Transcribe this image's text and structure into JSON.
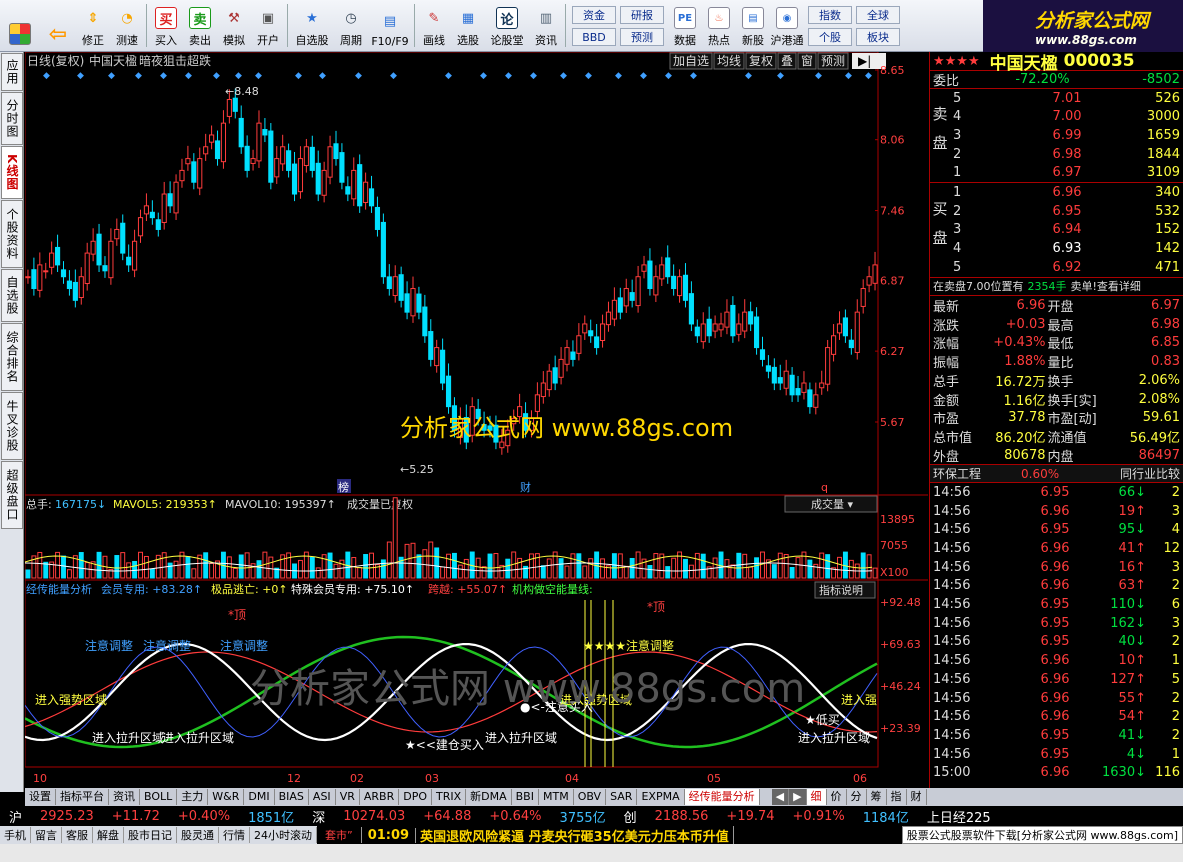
{
  "toolbar": {
    "buttons": [
      {
        "label": "修正",
        "icon": "up-down-arrow-icon"
      },
      {
        "label": "测速",
        "icon": "gauge-icon"
      },
      {
        "label": "买入",
        "icon": "buy-icon",
        "glyph": "买"
      },
      {
        "label": "卖出",
        "icon": "sell-icon",
        "glyph": "卖"
      },
      {
        "label": "模拟",
        "icon": "hammer-icon"
      },
      {
        "label": "开户",
        "icon": "lock-icon"
      },
      {
        "label": "自选股",
        "icon": "star-icon"
      },
      {
        "label": "周期",
        "icon": "clock-icon"
      },
      {
        "label": "F10/F9",
        "icon": "f10-icon"
      },
      {
        "label": "画线",
        "icon": "pen-icon"
      },
      {
        "label": "选股",
        "icon": "filter-icon"
      },
      {
        "label": "论股堂",
        "icon": "chat-icon",
        "glyph": "论"
      },
      {
        "label": "资讯",
        "icon": "news-icon"
      }
    ],
    "pair_buttons": [
      "资金",
      "研报",
      "BBD",
      "预测"
    ],
    "right_buttons": [
      {
        "label": "数据",
        "icon": "pe-icon"
      },
      {
        "label": "热点",
        "icon": "hot-icon"
      },
      {
        "label": "新股",
        "icon": "ipo-icon"
      },
      {
        "label": "沪港通",
        "icon": "sh-hk-icon"
      }
    ],
    "extra_buttons": [
      "指数",
      "全球",
      "个股",
      "板块"
    ]
  },
  "logo": {
    "title": "分析家公式网",
    "url": "www.88gs.com"
  },
  "left_tabs": [
    {
      "label": "应用"
    },
    {
      "label": "分时图"
    },
    {
      "label": "K线图",
      "active": true
    },
    {
      "label": "个股资料"
    },
    {
      "label": "自选股"
    },
    {
      "label": "综合排名"
    },
    {
      "label": "牛叉诊股"
    },
    {
      "label": "超级盘口"
    }
  ],
  "chart_header": {
    "title": "日线(复权)",
    "stock": "中国天楹",
    "note": "暗夜狙击超跌",
    "buttons": [
      "加自选",
      "均线",
      "复权",
      "叠",
      "窗",
      "预测"
    ]
  },
  "price_axis": [
    "8.65",
    "8.06",
    "7.46",
    "6.87",
    "6.27",
    "5.67"
  ],
  "annotations": {
    "high": "8.48",
    "low": "5.25",
    "mark1": "榜",
    "mark2": "财",
    "mark3": "q"
  },
  "watermark": "分析家公式网 www.88gs.com",
  "watermark2": "分析家公式网 www.88gs.com",
  "volume_header": {
    "total": "总手:",
    "total_val": "167175",
    "mavol5": "MAVOL5:",
    "mavol5_val": "219353",
    "mavol10": "MAVOL10:",
    "mavol10_val": "195397",
    "note": "成交量已复权",
    "select": "成交量"
  },
  "volume_axis": [
    "13895",
    "7055",
    "X100"
  ],
  "indicator_header": {
    "name": "经传能量分析",
    "l1": "会员专用:",
    "v1": "+83.28",
    "l2": "极品逃亡:",
    "v2": "+0",
    "l3": "特殊会员专用:",
    "v3": "+75.10",
    "l4": "跨越:",
    "v4": "+55.07",
    "l5": "机构做空能量线:",
    "help": "指标说明"
  },
  "indicator_axis": [
    "+92.48",
    "+69.63",
    "+46.24",
    "+23.39"
  ],
  "indicator_labels": [
    "注意调整",
    "注意调整",
    "注意调整",
    "进入强势区域",
    "进入拉升区域",
    "进入拉升区域",
    "★<<建仓买入",
    "进入拉升区域",
    "●<-注意买入",
    "进入强势区域",
    "★★★★注意调整",
    "*顶",
    "*顶",
    "★低买",
    "进入拉升区域",
    "进入强"
  ],
  "x_axis": [
    "10",
    "12",
    "02",
    "03",
    "04",
    "05",
    "06"
  ],
  "quote": {
    "stars": "★★★★",
    "name": "中国天楹",
    "code": "000035",
    "wei": [
      {
        "l": "委比",
        "v1": "-72.20%",
        "v2": "-8502"
      }
    ],
    "sell": [
      [
        "5",
        "7.01",
        "526"
      ],
      [
        "4",
        "7.00",
        "3000"
      ],
      [
        "3",
        "6.99",
        "1659"
      ],
      [
        "2",
        "6.98",
        "1844"
      ],
      [
        "1",
        "6.97",
        "3109"
      ]
    ],
    "buy": [
      [
        "1",
        "6.96",
        "340"
      ],
      [
        "2",
        "6.95",
        "532"
      ],
      [
        "3",
        "6.94",
        "152"
      ],
      [
        "4",
        "6.93",
        "142"
      ],
      [
        "5",
        "6.92",
        "471"
      ]
    ],
    "sell_label": "卖盘",
    "buy_label": "买盘",
    "note": "在卖盘7.00位置有",
    "note_v": "2354手",
    "note_tail": "卖单!查看详细",
    "stats": [
      [
        "最新",
        "6.96",
        "开盘",
        "6.97"
      ],
      [
        "涨跌",
        "+0.03",
        "最高",
        "6.98"
      ],
      [
        "涨幅",
        "+0.43%",
        "最低",
        "6.85"
      ],
      [
        "振幅",
        "1.88%",
        "量比",
        "0.83"
      ],
      [
        "总手",
        "16.72万",
        "换手",
        "2.06%"
      ],
      [
        "金额",
        "1.16亿",
        "换手[实]",
        "2.08%"
      ],
      [
        "市盈",
        "37.78",
        "市盈[动]",
        "59.61"
      ],
      [
        "总市值",
        "86.20亿",
        "流通值",
        "56.49亿"
      ],
      [
        "外盘",
        "80678",
        "内盘",
        "86497"
      ]
    ],
    "sector": "环保工程",
    "sector_v": "0.60%",
    "compare": "同行业比较",
    "ticks": [
      [
        "14:56",
        "6.95",
        "66",
        "dn",
        "2"
      ],
      [
        "14:56",
        "6.96",
        "19",
        "up",
        "3"
      ],
      [
        "14:56",
        "6.95",
        "95",
        "dn",
        "4"
      ],
      [
        "14:56",
        "6.96",
        "41",
        "up",
        "12"
      ],
      [
        "14:56",
        "6.96",
        "16",
        "up",
        "3"
      ],
      [
        "14:56",
        "6.96",
        "63",
        "up",
        "2"
      ],
      [
        "14:56",
        "6.95",
        "110",
        "dn",
        "6"
      ],
      [
        "14:56",
        "6.95",
        "162",
        "dn",
        "3"
      ],
      [
        "14:56",
        "6.95",
        "40",
        "dn",
        "2"
      ],
      [
        "14:56",
        "6.96",
        "10",
        "up",
        "1"
      ],
      [
        "14:56",
        "6.96",
        "127",
        "up",
        "5"
      ],
      [
        "14:56",
        "6.96",
        "55",
        "up",
        "2"
      ],
      [
        "14:56",
        "6.96",
        "54",
        "up",
        "2"
      ],
      [
        "14:56",
        "6.95",
        "41",
        "dn",
        "2"
      ],
      [
        "14:56",
        "6.95",
        "4",
        "dn",
        "1"
      ],
      [
        "15:00",
        "6.96",
        "1630",
        "dn",
        "116"
      ]
    ]
  },
  "bottom_tabs": [
    "设置",
    "指标平台",
    "资讯",
    "BOLL",
    "主力",
    "W&R",
    "DMI",
    "BIAS",
    "ASI",
    "VR",
    "ARBR",
    "DPO",
    "TRIX",
    "新DMA",
    "BBI",
    "MTM",
    "OBV",
    "SAR",
    "EXPMA",
    "经传能量分析"
  ],
  "side_tabs": [
    "细",
    "价",
    "分",
    "筹",
    "指",
    "财"
  ],
  "ticker": {
    "sh": "沪",
    "sh_v": "2925.23",
    "sh_c": "+11.72",
    "sh_p": "+0.40%",
    "sh_a": "1851亿",
    "sz": "深",
    "sz_v": "10274.03",
    "sz_c": "+64.88",
    "sz_p": "+0.64%",
    "sz_a": "3755亿",
    "cy": "创",
    "cy_v": "2188.56",
    "cy_c": "+19.74",
    "cy_p": "+0.91%",
    "cy_a": "1184亿",
    "ex": "上日经225"
  },
  "status": {
    "items": [
      "手机",
      "留言",
      "客服",
      "解盘",
      "股市日记",
      "股灵通",
      "行情",
      "24小时滚动"
    ],
    "hot": "套市”",
    "time": "01:09",
    "news": "英国退欧风险紧逼 丹麦央行砸35亿美元力压本币升值",
    "ad": "股票公式股票软件下载[分析家公式网 www.88gs.com]"
  }
}
